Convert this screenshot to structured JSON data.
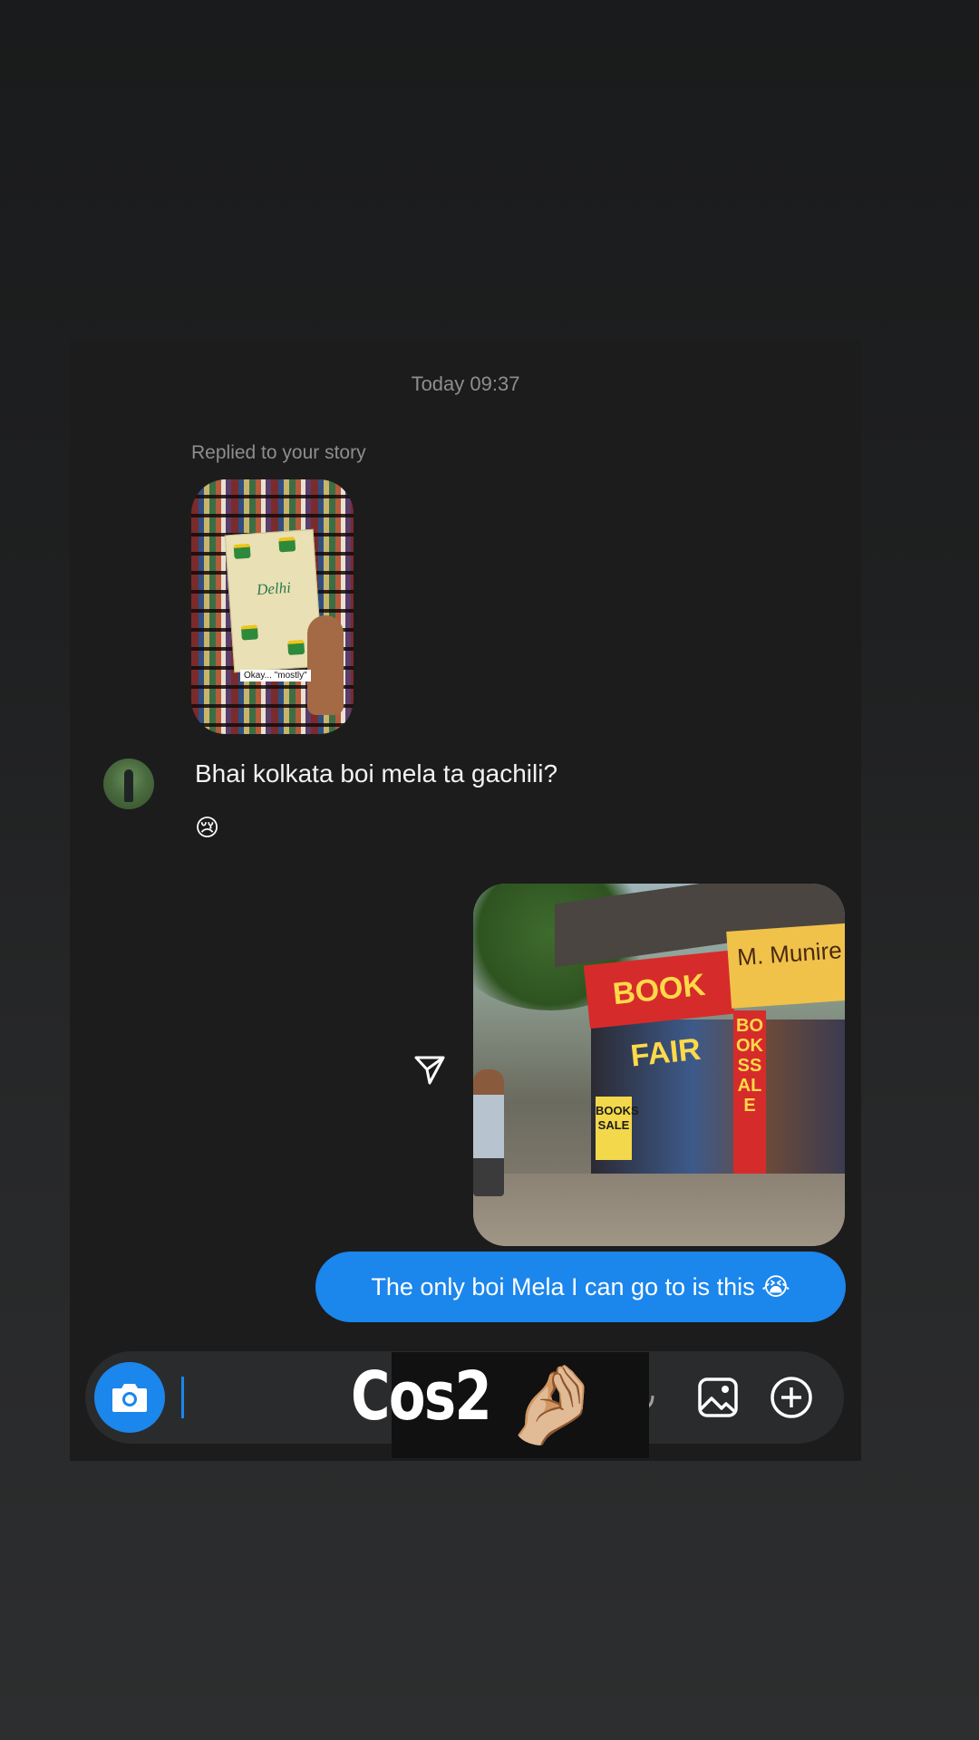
{
  "chat": {
    "timestamp": "Today 09:37",
    "story_reply": {
      "label": "Replied to your story",
      "thumbnail_book_title": "Delhi",
      "thumbnail_caption": "Okay... \"mostly\""
    },
    "received_message": {
      "text": "Bhai kolkata boi mela ta gachili?",
      "reaction_emoji": "😢"
    },
    "sent_photo": {
      "sign_text": "BOOK FAIR",
      "shop_sign_text": "M. Munire",
      "vertical_sign_text": "BOOKSSALE",
      "board_text": "BOOKS SALE"
    },
    "sent_message": {
      "text": "The only boi Mela I can go to is this 😭"
    }
  },
  "composer": {
    "camera_icon": "camera-icon",
    "mic_icon": "microphone-icon",
    "gallery_icon": "gallery-icon",
    "plus_icon": "plus-circle-icon"
  },
  "sticker": {
    "text": "Cos2",
    "emoji": "🤌🏼"
  },
  "colors": {
    "accent": "#1b86ec",
    "background": "#1c1c1d",
    "muted_text": "#8e8e90"
  }
}
